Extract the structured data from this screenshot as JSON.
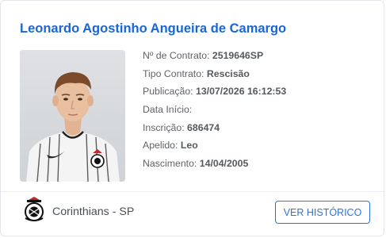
{
  "player": {
    "name": "Leonardo Agostinho Angueira de Camargo"
  },
  "fields": [
    {
      "label": "Nº de Contrato:",
      "value": "2519646SP"
    },
    {
      "label": "Tipo Contrato:",
      "value": "Rescisão"
    },
    {
      "label": "Publicação:",
      "value": "13/07/2026 16:12:53"
    },
    {
      "label": "Data Início:",
      "value": ""
    },
    {
      "label": "Inscrição:",
      "value": "686474"
    },
    {
      "label": "Apelido:",
      "value": "Leo"
    },
    {
      "label": "Nascimento:",
      "value": "14/04/2005"
    }
  ],
  "club": {
    "name": "Corinthians - SP",
    "crest_icon": "corinthians-crest-icon"
  },
  "actions": {
    "history_label": "VER HISTÓRICO"
  },
  "colors": {
    "name": "#1a66d8",
    "button": "#2f73d6"
  }
}
